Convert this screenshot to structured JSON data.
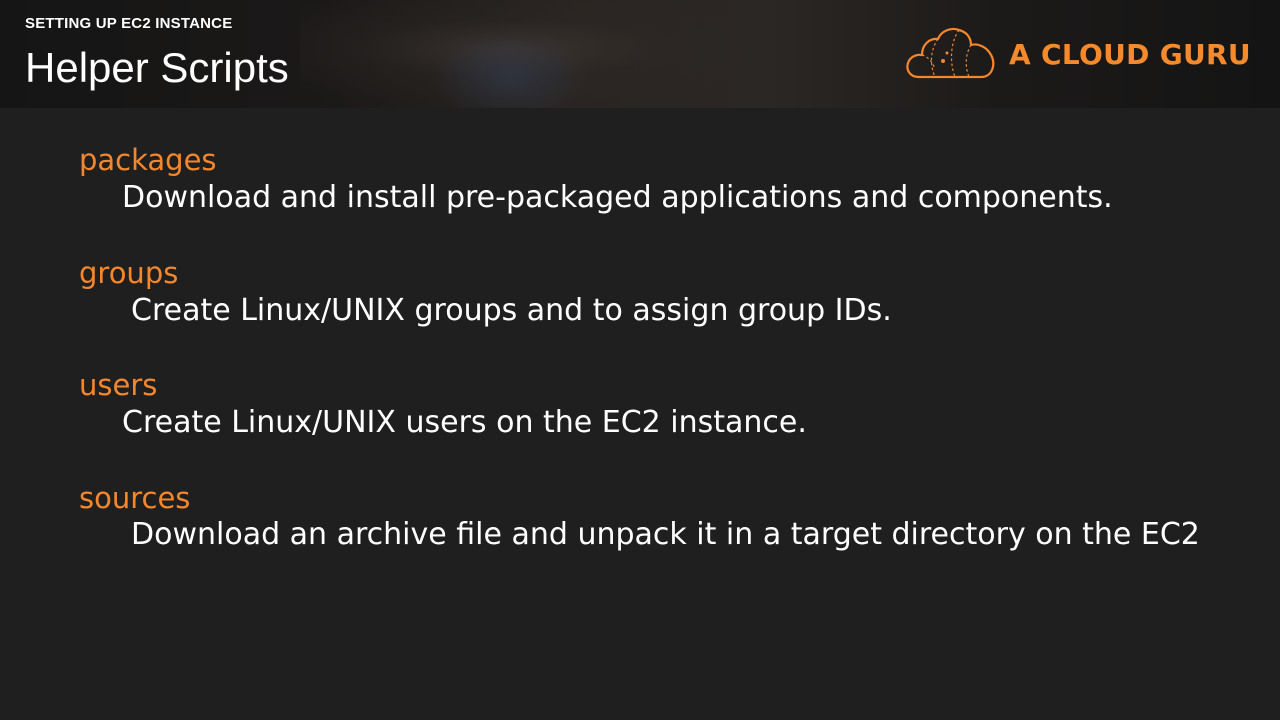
{
  "header": {
    "section_label": "SETTING UP EC2 INSTANCE",
    "title": "Helper Scripts",
    "logo_text": "A CLOUD GURU",
    "logo_icon": "cloud-icon"
  },
  "items": [
    {
      "term": "packages",
      "description": "Download and install pre-packaged applications and components."
    },
    {
      "term": "groups",
      "description": "Create Linux/UNIX groups and to assign group IDs."
    },
    {
      "term": "users",
      "description": "Create Linux/UNIX users on the EC2 instance."
    },
    {
      "term": "sources",
      "description": "Download an archive file and unpack it in a target directory on the EC2"
    }
  ],
  "colors": {
    "background": "#1f1f1f",
    "accent": "#f4872c",
    "text": "#ffffff"
  }
}
